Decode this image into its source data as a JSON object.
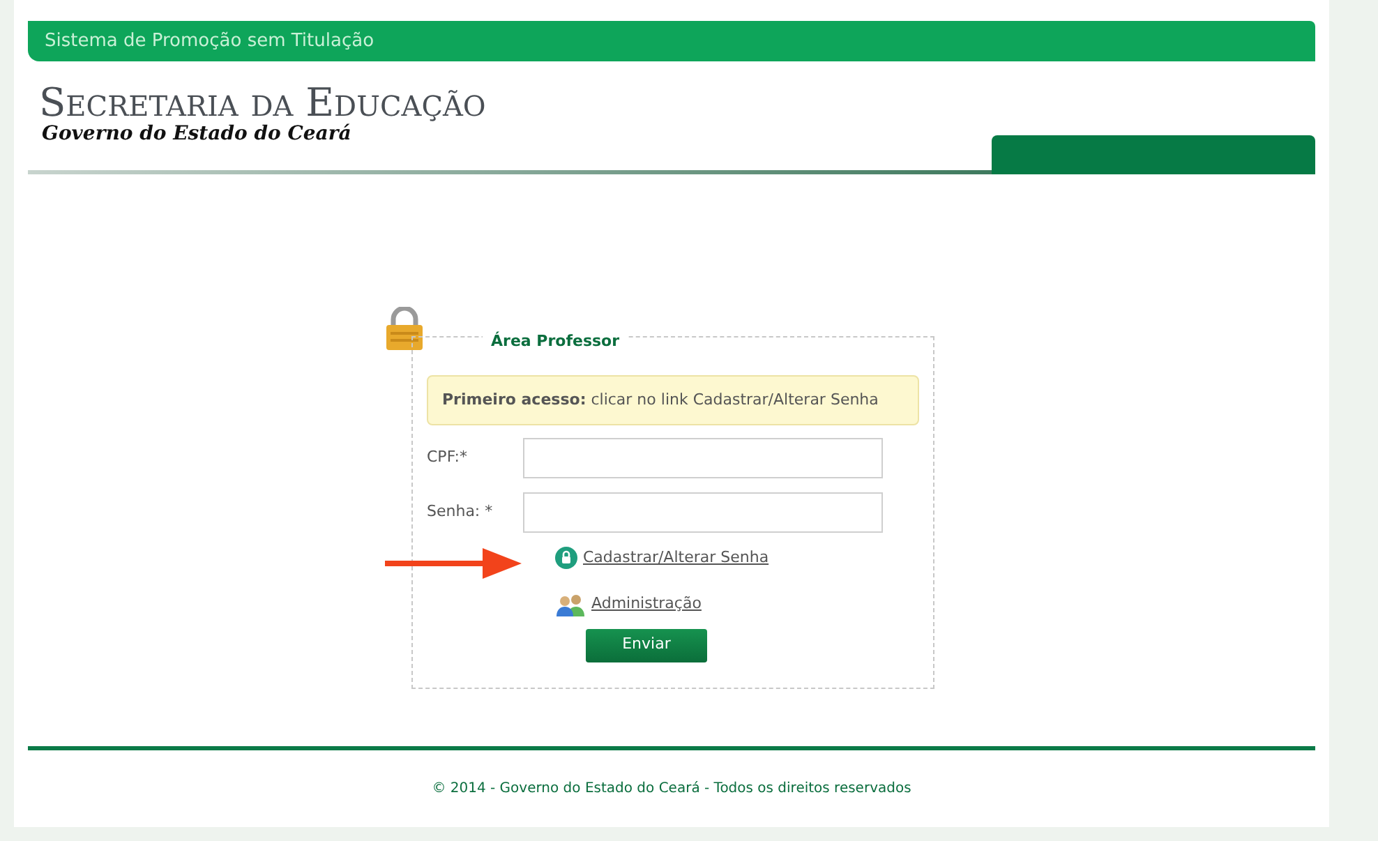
{
  "banner": {
    "title": "Sistema de Promoção sem Titulação"
  },
  "header": {
    "title": "Secretaria da Educação",
    "subtitle": "Governo do Estado do Ceará"
  },
  "login": {
    "title": "Área Professor",
    "notice": "**Primeiro acesso:** clicar no link Cadastrar/Alterar Senha",
    "fields": [
      {
        "label": "CPF:*"
      },
      {
        "label": "Senha: *"
      }
    ],
    "links": [
      {
        "kind": "lock",
        "label": "Cadastrar/Alterar Senha"
      },
      {
        "kind": "users",
        "label": "Administração"
      }
    ],
    "submit": "Enviar"
  },
  "footer": {
    "text": "© 2014 - Governo do Estado do Ceará - Todos os direitos reservados"
  }
}
